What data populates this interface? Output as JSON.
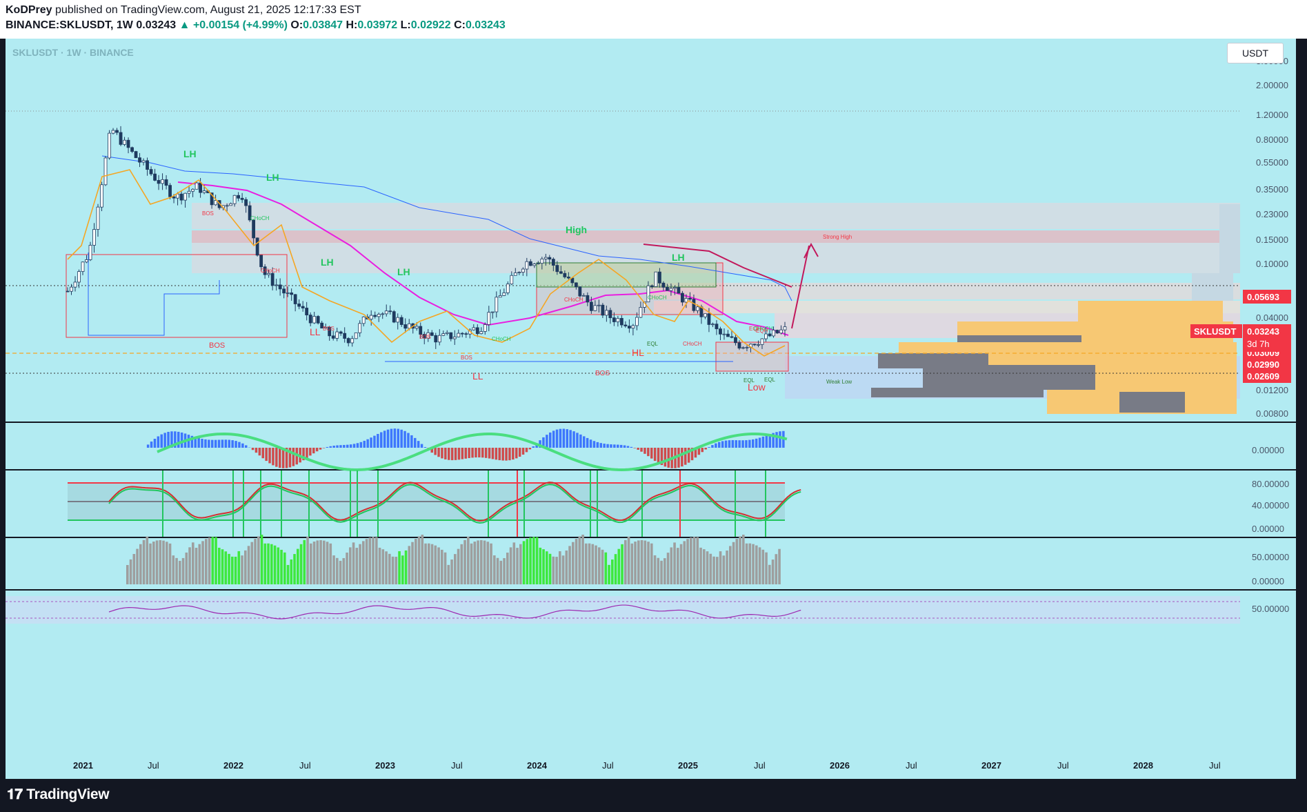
{
  "header": {
    "publisher": "KoDPrey",
    "published_text": "published on TradingView.com, August 21, 2025 12:17:33 EST",
    "symbol_line": "BINANCE:SKLUSDT, 1W",
    "last": "0.03243",
    "change": "+0.00154 (+4.99%)",
    "o_label": "O:",
    "o": "0.03847",
    "h_label": "H:",
    "h": "0.03972",
    "l_label": "L:",
    "l": "0.02922",
    "c_label": "C:",
    "c": "0.03243"
  },
  "chart": {
    "symbol_title": "SKLUSDT · 1W · BINANCE",
    "currency": "USDT",
    "ticker_tag": "SKLUSDT",
    "ticker_price": "0.03243",
    "countdown": "3d 7h"
  },
  "colors": {
    "background": "#b2ebf2",
    "up": "#089981",
    "down": "#f23645",
    "ma_magenta": "#e91ee0",
    "ma_orange": "#f5a623",
    "vwap_blue": "#2962ff"
  },
  "chart_data": {
    "type": "candlestick",
    "price_axis_labels": [
      "3.00000",
      "2.00000",
      "1.20000",
      "0.80000",
      "0.55000",
      "0.35000",
      "0.23000",
      "0.15000",
      "0.10000",
      "0.05693",
      "0.04000",
      "0.03243",
      "0.03009",
      "0.02990",
      "0.02609",
      "0.01200",
      "0.00800"
    ],
    "price_tags": [
      {
        "value": "0.05693",
        "color": "#f23645"
      },
      {
        "value": "0.03009",
        "color": "#f23645"
      },
      {
        "value": "0.02990",
        "color": "#f23645"
      },
      {
        "value": "0.02609",
        "color": "#f23645"
      }
    ],
    "time_axis_labels": [
      "2021",
      "Jul",
      "2022",
      "Jul",
      "2023",
      "Jul",
      "2024",
      "Jul",
      "2025",
      "Jul",
      "2026",
      "Jul",
      "2027",
      "Jul",
      "2028",
      "Jul"
    ],
    "annotations": [
      "LH",
      "LH",
      "LH",
      "LH",
      "High",
      "LH",
      "LL",
      "LL",
      "HL",
      "Low",
      "BOS",
      "BOS",
      "BOS",
      "BOS",
      "BOS",
      "BOS",
      "CHoCH",
      "CHoCH",
      "CHoCH",
      "CHoCH",
      "CHoCH",
      "EQH",
      "EQH",
      "EQL",
      "EQL",
      "EQL",
      "Strong High",
      "Weak Low"
    ],
    "panes": [
      {
        "name": "price",
        "axis_labels": [
          "3.00000",
          "0.00800"
        ]
      },
      {
        "name": "momentum",
        "axis_labels": [
          "0.00000"
        ]
      },
      {
        "name": "stochastic",
        "axis_labels": [
          "80.00000",
          "40.00000",
          "0.00000"
        ]
      },
      {
        "name": "volume-strength",
        "axis_labels": [
          "50.00000",
          "0.00000"
        ]
      },
      {
        "name": "rsi",
        "axis_labels": [
          "50.00000"
        ]
      }
    ],
    "approx_close_path": [
      0.062,
      0.12,
      0.95,
      0.62,
      0.42,
      0.3,
      0.36,
      0.25,
      0.33,
      0.085,
      0.06,
      0.042,
      0.03,
      0.028,
      0.045,
      0.04,
      0.032,
      0.028,
      0.03,
      0.034,
      0.06,
      0.1,
      0.11,
      0.075,
      0.05,
      0.04,
      0.036,
      0.08,
      0.06,
      0.045,
      0.03,
      0.025,
      0.028,
      0.03243
    ]
  },
  "footer": {
    "brand": "TradingView"
  }
}
